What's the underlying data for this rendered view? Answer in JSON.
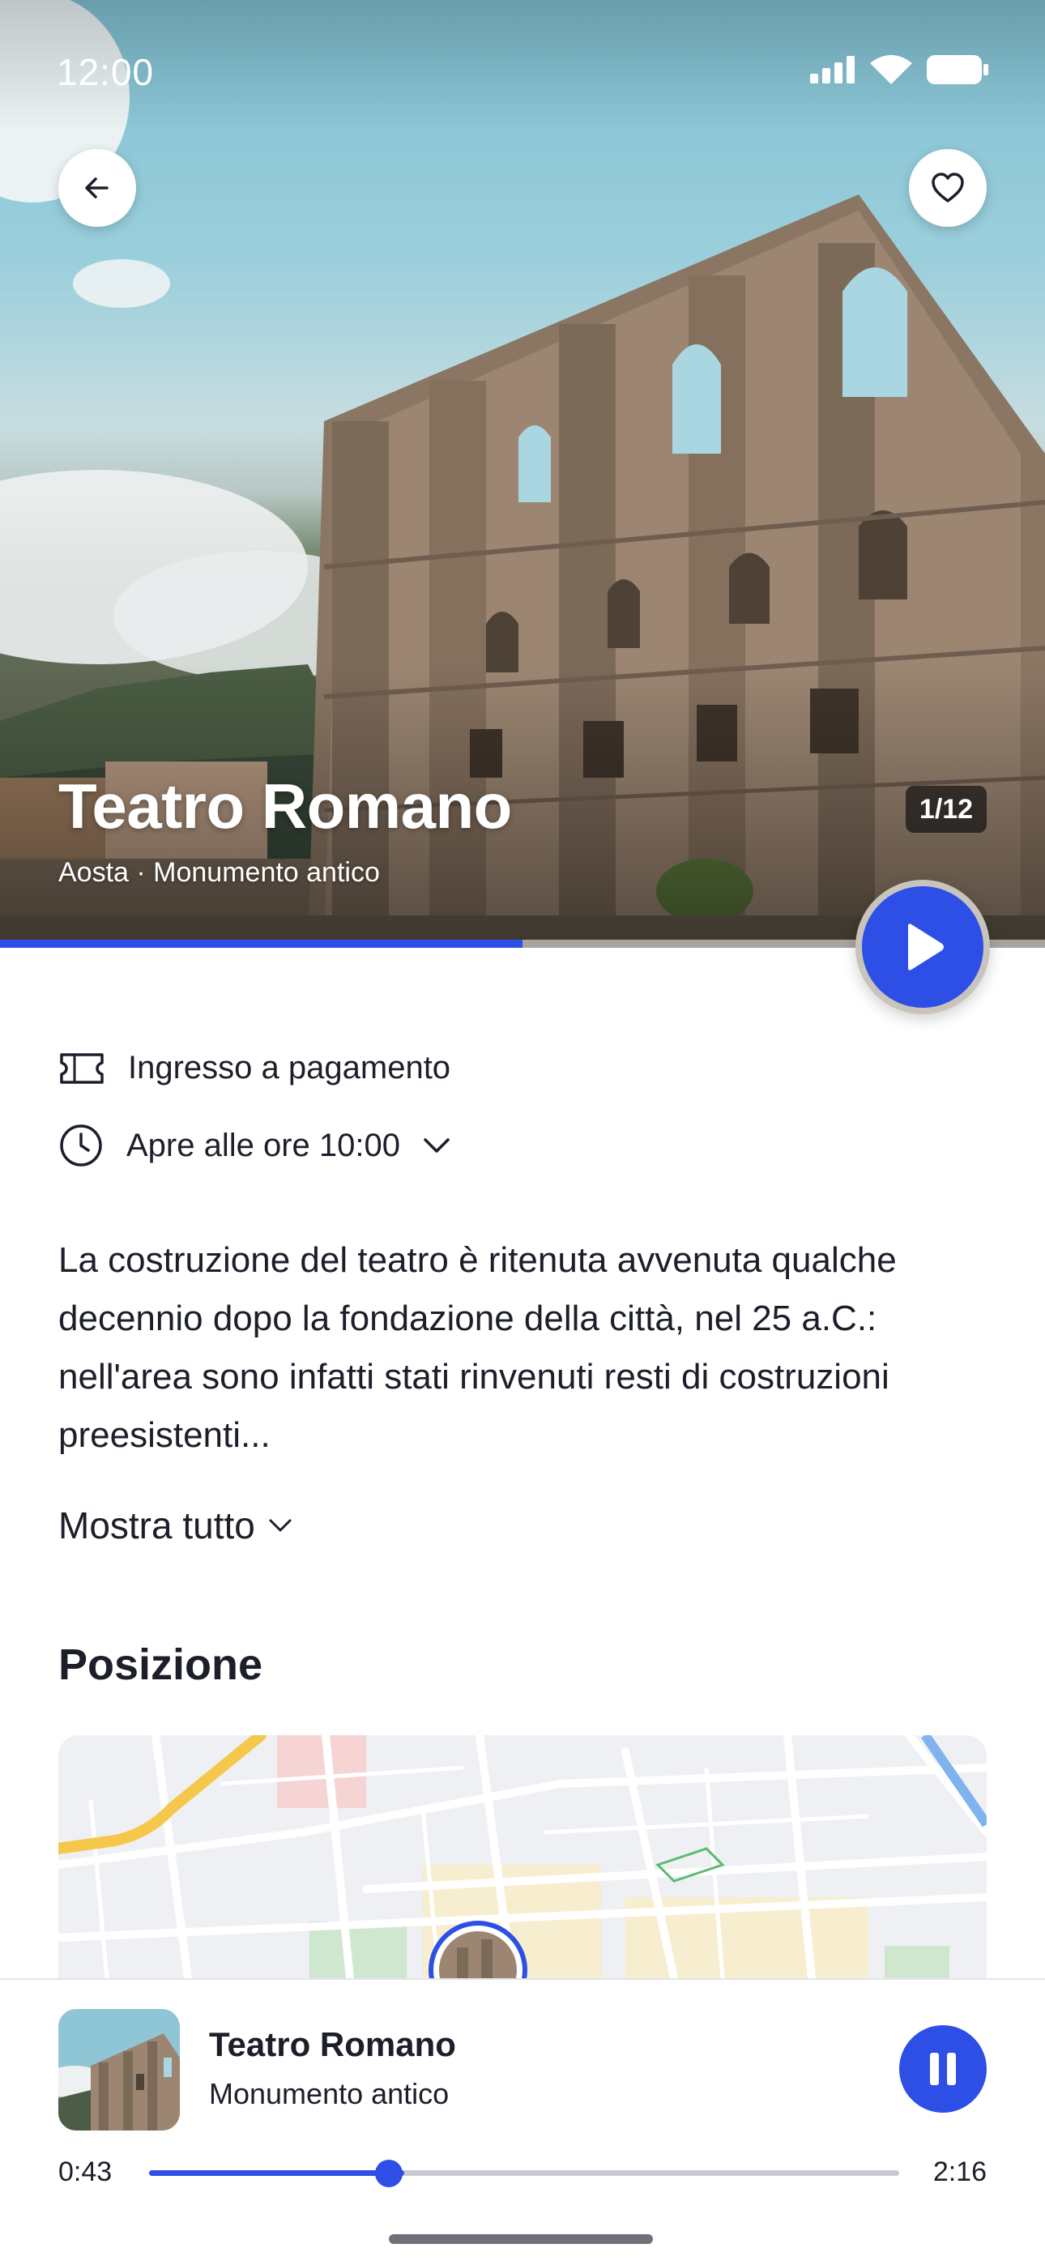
{
  "status_bar": {
    "time": "12:00"
  },
  "hero": {
    "title": "Teatro Romano",
    "subtitle": "Aosta · Monumento antico",
    "photo_counter": "1/12",
    "progress": 0.5
  },
  "info": {
    "ticket_label": "Ingresso a pagamento",
    "hours_label": "Apre alle ore 10:00"
  },
  "description": "La costruzione del teatro è ritenuta avvenuta qualche decennio dopo la fondazione della città, nel 25 a.C.: nell'area sono infatti stati rinvenuti resti di costruzioni preesistenti...",
  "show_all_label": "Mostra tutto",
  "location": {
    "section_title": "Posizione"
  },
  "player": {
    "title": "Teatro Romano",
    "subtitle": "Monumento antico",
    "elapsed": "0:43",
    "duration": "2:16",
    "position_fraction": 0.32,
    "buffered_fraction": 0.34
  },
  "colors": {
    "accent": "#2d4fe6",
    "text": "#1c1f2a"
  },
  "icons": [
    "back-arrow-icon",
    "heart-icon",
    "play-icon",
    "ticket-icon",
    "clock-icon",
    "chevron-down-icon",
    "pause-icon",
    "signal-icon",
    "wifi-icon",
    "battery-icon"
  ]
}
